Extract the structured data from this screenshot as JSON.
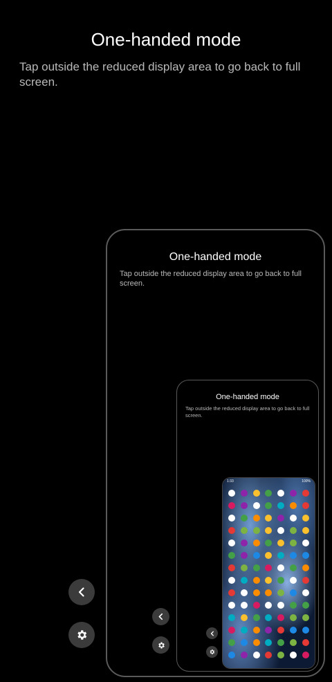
{
  "screen": {
    "title": "One-handed mode",
    "description": "Tap outside the reduced display area to go back to full screen."
  },
  "preview_level_1": {
    "title": "One-handed mode",
    "description": "Tap outside the reduced display area to go back to full screen."
  },
  "preview_level_2": {
    "title": "One-handed mode",
    "description": "Tap outside the reduced display area to go back to full screen."
  },
  "preview_level_3": {
    "status_time": "1:33",
    "status_battery": "100%"
  },
  "controls": {
    "back_icon": "chevron-left-icon",
    "settings_icon": "gear-icon"
  },
  "colors": {
    "background": "#000000",
    "frame_border": "#5a5a5a",
    "button_bg": "#3b3b3b",
    "description_text": "#b9b9b9"
  }
}
